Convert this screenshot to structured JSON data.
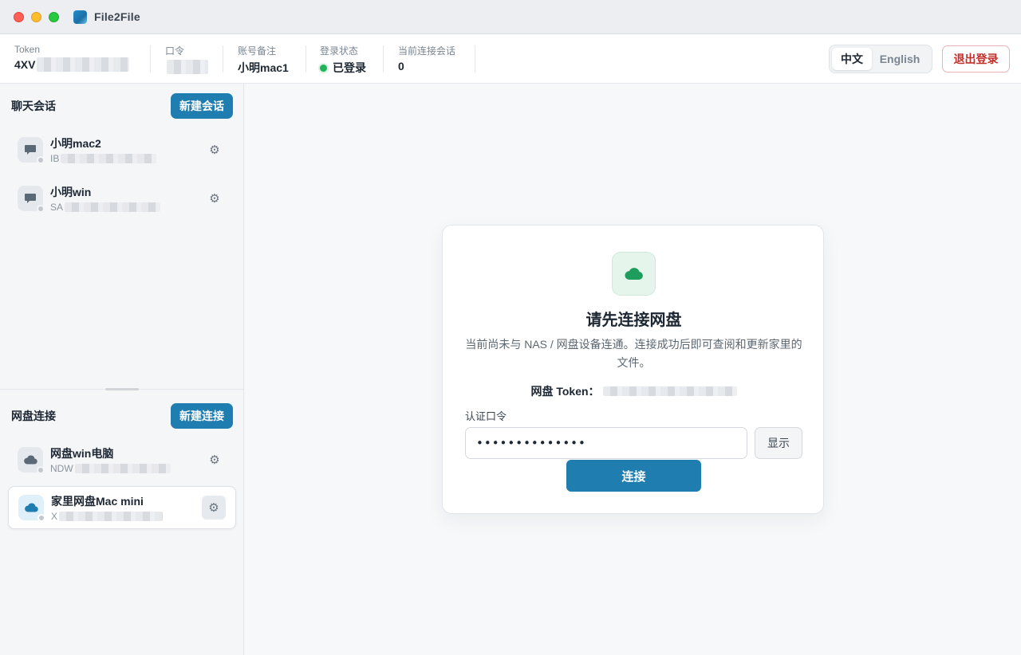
{
  "app": {
    "title": "File2File"
  },
  "header": {
    "token": {
      "label": "Token",
      "value": "4XV"
    },
    "passcode": {
      "label": "口令",
      "value": ""
    },
    "account_note": {
      "label": "账号备注",
      "value": "小明mac1"
    },
    "login_status": {
      "label": "登录状态",
      "value": "已登录"
    },
    "sessions": {
      "label": "当前连接会话",
      "value": "0"
    },
    "lang": {
      "zh": "中文",
      "en": "English",
      "selected": "中文"
    },
    "logout_label": "退出登录"
  },
  "chat": {
    "title": "聊天会话",
    "new_label": "新建会话",
    "items": [
      {
        "name": "小明mac2",
        "sub": "IB"
      },
      {
        "name": "小明win",
        "sub": "SA"
      }
    ]
  },
  "disk": {
    "title": "网盘连接",
    "new_label": "新建连接",
    "items": [
      {
        "name": "网盘win电脑",
        "sub": "NDW"
      },
      {
        "name": "家里网盘Mac mini",
        "sub": "X"
      }
    ]
  },
  "connect_card": {
    "title": "请先连接网盘",
    "description": "当前尚未与 NAS / 网盘设备连通。连接成功后即可查阅和更新家里的文件。",
    "token_label": "网盘 Token：",
    "password_label": "认证口令",
    "password_value": "••••••••••••••",
    "show_label": "显示",
    "connect_label": "连接"
  },
  "colors": {
    "accent": "#1f7db0",
    "online": "#1fb35a",
    "danger": "#c0302b"
  },
  "icons": [
    "chat-bubble-icon",
    "cloud-icon",
    "gear-icon"
  ]
}
